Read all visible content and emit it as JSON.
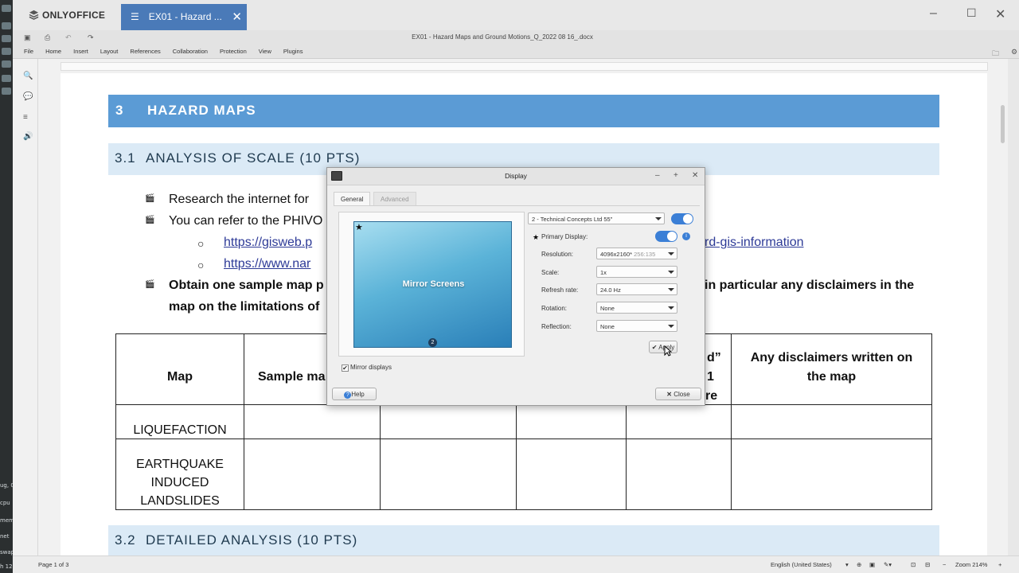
{
  "dock": {
    "labels": [
      "ug, 0",
      "cpu",
      "mem",
      "net",
      "swap",
      "h 12:"
    ]
  },
  "app": {
    "brand": "ONLYOFFICE",
    "tab_title": "EX01 - Hazard ...",
    "doc_title": "EX01 - Hazard Maps and Ground Motions_Q_2022 08 16_.docx"
  },
  "menu": [
    "File",
    "Home",
    "Insert",
    "Layout",
    "References",
    "Collaboration",
    "Protection",
    "View",
    "Plugins"
  ],
  "document": {
    "h3_num": "3",
    "h3_text": "HAZARD MAPS",
    "h31_num": "3.1",
    "h31_text": "ANALYSIS OF SCALE (10 PTS)",
    "bullet1": "Research the internet for",
    "bullet2": "You can refer to the PHIVO",
    "link1": "https://gisweb.p",
    "link1_tail": "rd-gis-information",
    "link2": "https://www.nar",
    "bullet3_a": "Obtain one sample map p",
    "bullet3_b": "in particular any disclaimers in the",
    "bullet3_c": "map on the limitations of",
    "h32_num": "3.2",
    "h32_text": "DETAILED ANALYSIS (10 PTS)"
  },
  "table": {
    "h_map": "Map",
    "h_sample": "Sample ma",
    "h_frag1": "d”",
    "h_frag2": "1",
    "h_frag3": "re",
    "h_disclaimer1": "Any disclaimers written on",
    "h_disclaimer2": "the map",
    "row1": "LIQUEFACTION",
    "row2_l1": "EARTHQUAKE",
    "row2_l2": "INDUCED",
    "row2_l3": "LANDSLIDES"
  },
  "dialog": {
    "title": "Display",
    "tab_general": "General",
    "tab_advanced": "Advanced",
    "preview_label": "Mirror Screens",
    "preview_badge": "2",
    "monitor": "2 - Technical Concepts Ltd 55\"",
    "primary_label": "Primary Display:",
    "resolution_label": "Resolution:",
    "resolution_value": "4096x2160*",
    "resolution_ratio": "256:135",
    "scale_label": "Scale:",
    "scale_value": "1x",
    "refresh_label": "Refresh rate:",
    "refresh_value": "24.0 Hz",
    "rotation_label": "Rotation:",
    "rotation_value": "None",
    "reflection_label": "Reflection:",
    "reflection_value": "None",
    "apply": "Apply",
    "mirror": "Mirror displays",
    "help": "Help",
    "close": "Close"
  },
  "status": {
    "page": "Page 1 of 3",
    "language": "English (United States)",
    "zoom": "Zoom 214%"
  },
  "colors": {
    "tab": "#4a7ab8",
    "heading": "#5b9bd5",
    "subheading": "#dbeaf6",
    "toggle": "#3b7fd6"
  }
}
